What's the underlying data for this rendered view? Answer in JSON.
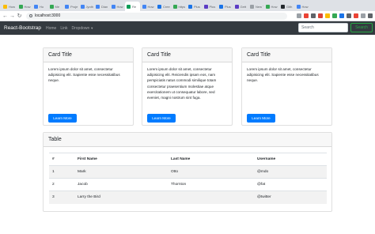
{
  "browser": {
    "tabs": [
      {
        "label": "How",
        "color": "#fbbc04"
      },
      {
        "label": "How",
        "color": "#34a853"
      },
      {
        "label": "Ho",
        "color": "#4285f4"
      },
      {
        "label": "Me",
        "color": "#34a853"
      },
      {
        "label": "Proje",
        "color": "#4285f4"
      },
      {
        "label": "Jyoth",
        "color": "#4285f4"
      },
      {
        "label": "Dian",
        "color": "#4285f4"
      },
      {
        "label": "How",
        "color": "#4285f4"
      },
      {
        "label": "Re",
        "color": "#0f9d58",
        "active": true
      },
      {
        "label": "How",
        "color": "#4285f4"
      },
      {
        "label": "Cree",
        "color": "#1a73e8"
      },
      {
        "label": "https",
        "color": "#34a853"
      },
      {
        "label": "Plus",
        "color": "#1a73e8"
      },
      {
        "label": "Plus",
        "color": "#5b3cc4"
      },
      {
        "label": "Plus",
        "color": "#1a73e8"
      },
      {
        "label": "Gett",
        "color": "#5b3cc4"
      },
      {
        "label": "New Tab",
        "color": "#9aa0a6"
      },
      {
        "label": "How",
        "color": "#34a853"
      },
      {
        "label": "Gith",
        "color": "#24292e"
      },
      {
        "label": "How",
        "color": "#4285f4"
      }
    ],
    "url": "localhost:3000",
    "extensions": [
      "#9aa0a6",
      "#ea4335",
      "#5f6368",
      "#db4437",
      "#fbbc04",
      "#34a853",
      "#1a73e8",
      "#5f6368",
      "#ea4335",
      "#9aa0a6",
      "#5f6368"
    ]
  },
  "navbar": {
    "brand": "React-Bootstrap",
    "links": [
      "Home",
      "Link"
    ],
    "dropdown_label": "Dropdown",
    "search_placeholder": "Search",
    "search_button": "Search"
  },
  "cards": [
    {
      "title": "Card Title",
      "text": "Lorem ipsum dolor sit amet, consectetur adipisicing elit. Sapiente esse necessitatibus neque.",
      "button": "Learn More"
    },
    {
      "title": "Card Title",
      "text": "Lorem ipsum dolor sit amet, consectetur adipisicing elit. Reiciendis ipsam eos, nam perspiciatis natus commodi similique totam consectetur praesentium molestiae atque exercitationem ut consequatur labore, sed eveniet, magni nostrum sint fuga.",
      "button": "Learn More"
    },
    {
      "title": "Card Title",
      "text": "Lorem ipsum dolor sit amet, consectetur adipisicing elit. Sapiente esse necessitatibus neque.",
      "button": "Learn More"
    }
  ],
  "table_card": {
    "title": "Table",
    "headers": [
      "#",
      "First Name",
      "Last Name",
      "Username"
    ],
    "rows": [
      [
        "1",
        "Mark",
        "Otto",
        "@mdo"
      ],
      [
        "2",
        "Jacob",
        "Thornton",
        "@fat"
      ],
      [
        "3",
        "Larry the Bird",
        "",
        "@twitter"
      ]
    ]
  }
}
